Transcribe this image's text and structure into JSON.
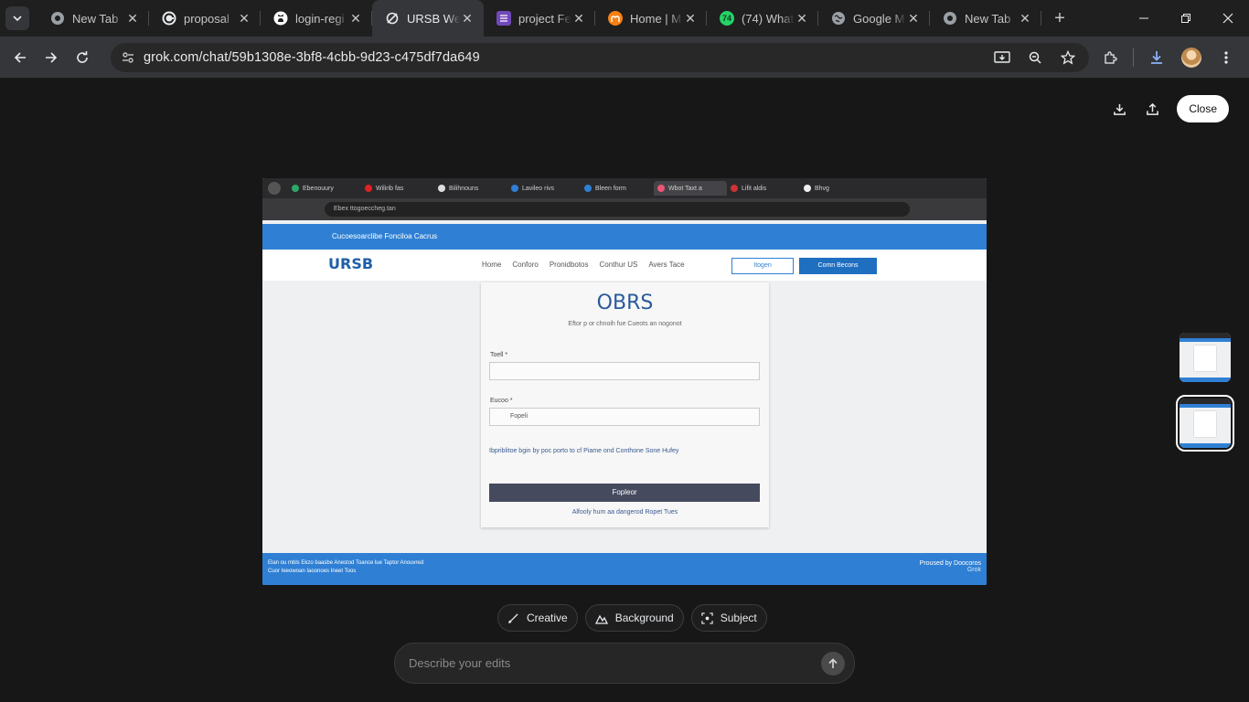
{
  "browser": {
    "tabs": [
      {
        "title": "New Tab",
        "icon": "chrome-icon",
        "color": "#9aa0a6"
      },
      {
        "title": "proposal",
        "icon": "grammarly-icon",
        "color": "#15c39a"
      },
      {
        "title": "login-regi",
        "icon": "github-icon",
        "color": "#ffffff"
      },
      {
        "title": "URSB Wel",
        "icon": "grok-icon",
        "color": "#e8eaed",
        "active": true
      },
      {
        "title": "project Fe",
        "icon": "forms-icon",
        "color": "#7248b9"
      },
      {
        "title": "Home | M",
        "icon": "moodle-icon",
        "color": "#f98012"
      },
      {
        "title": "(74) What",
        "icon": "whatsapp-icon",
        "color": "#25d366",
        "badge": "74"
      },
      {
        "title": "Google M",
        "icon": "globe-icon",
        "color": "#9aa0a6"
      },
      {
        "title": "New Tab",
        "icon": "chrome-icon",
        "color": "#9aa0a6"
      }
    ],
    "url": "grok.com/chat/59b1308e-3bf8-4cbb-9d23-c475df7da649"
  },
  "viewer": {
    "close_label": "Close"
  },
  "preview": {
    "inner_tabs": [
      "Ebenouury",
      "Wilirib fas",
      "Bilihnouns",
      "Lavileo rivs",
      "Bleen form",
      "Wbot Taxt a",
      "Lifit aldis",
      "Bhvg"
    ],
    "inner_url": "Ebex ttogoeccheg.tan",
    "banner": "Cucoesoarclibe Fonciloa Cacrus",
    "logo": "URSB",
    "nav_links": [
      "Home",
      "Conforo",
      "Pronidbotos",
      "Conthur US",
      "Avers Tace"
    ],
    "nav_login": "Itogen",
    "nav_register": "Comn Becons",
    "title": "OBRS",
    "subtitle": "Eftor p or chnoih fue Cueots an nogonot",
    "field1_label": "Toell *",
    "field2_label": "Eucoo *",
    "field2_value": "Fopeli",
    "checkbox_text": "Ibpriblitoe bgin by poc porto to cf Piame ond Conthone Sone Hufey",
    "submit_label": "Fopleor",
    "foot_link": "Alfooly hum aa dangerod Ropet Tues",
    "footer_left": "Elan ou mbls Ekzo baasbe Anestod Toance lue Taptor Anouvred",
    "footer_left2": "Cuor Ieeowoan Iaoonoes Ineet Toos",
    "footer_right": "Proused by Doocoros",
    "footer_brand": "Grok"
  },
  "edit": {
    "chips": [
      {
        "label": "Creative",
        "icon": "brush-icon"
      },
      {
        "label": "Background",
        "icon": "landscape-icon"
      },
      {
        "label": "Subject",
        "icon": "focus-icon"
      }
    ],
    "prompt_placeholder": "Describe your edits"
  }
}
